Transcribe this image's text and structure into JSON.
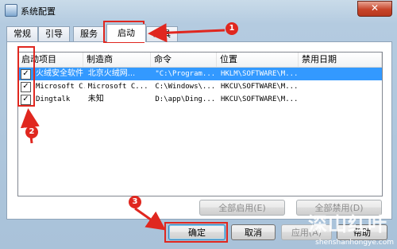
{
  "window": {
    "title": "系统配置",
    "close_label": "✕"
  },
  "tabs": [
    {
      "label": "常规",
      "active": false
    },
    {
      "label": "引导",
      "active": false
    },
    {
      "label": "服务",
      "active": false
    },
    {
      "label": "启动",
      "active": true
    },
    {
      "label": "工具",
      "active": false
    }
  ],
  "list": {
    "columns": [
      "启动项目",
      "制造商",
      "命令",
      "位置",
      "禁用日期"
    ],
    "rows": [
      {
        "checked": true,
        "selected": true,
        "item": "火绒安全软件",
        "maker": "北京火绒网...",
        "command": "\"C:\\Program...",
        "location": "HKLM\\SOFTWARE\\M...",
        "disabled_date": ""
      },
      {
        "checked": true,
        "selected": false,
        "item": "Microsoft C...",
        "maker": "Microsoft C...",
        "command": "C:\\Windows\\...",
        "location": "HKCU\\SOFTWARE\\M...",
        "disabled_date": ""
      },
      {
        "checked": true,
        "selected": false,
        "item": "Dingtalk",
        "maker": "未知",
        "command": "D:\\app\\Ding...",
        "location": "HKCU\\SOFTWARE\\M...",
        "disabled_date": ""
      }
    ]
  },
  "buttons": {
    "enable_all": "全部启用(E)",
    "disable_all": "全部禁用(D)",
    "ok": "确定",
    "cancel": "取消",
    "apply": "应用(A)",
    "help": "帮助"
  },
  "annotations": {
    "badge1": "1",
    "badge2": "2",
    "badge3": "3"
  },
  "watermark": {
    "logo": "深山红叶",
    "url": "shenshanhongye.com"
  },
  "colors": {
    "annotation_red": "#e0271f",
    "selection_blue": "#3399ff"
  }
}
